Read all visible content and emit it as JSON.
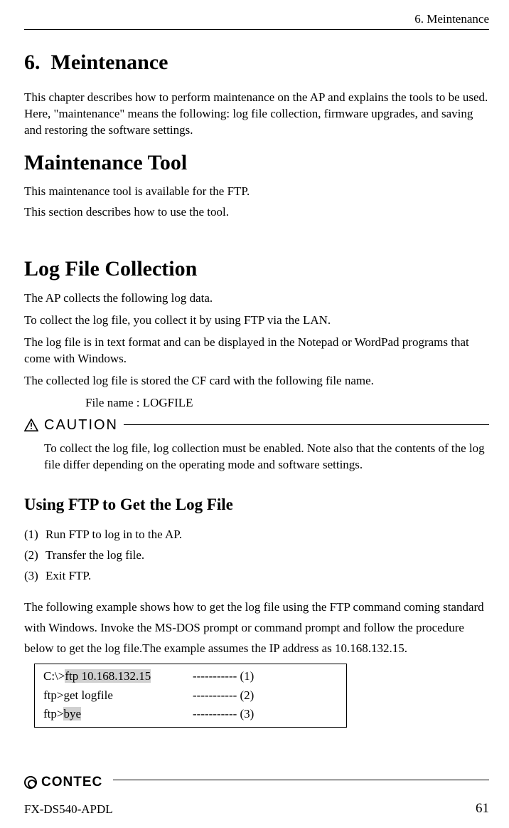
{
  "running_head": "6. Meintenance",
  "chapter": {
    "number": "6.",
    "title": "Meintenance"
  },
  "intro": "This chapter describes how to perform maintenance on the AP and explains the tools to be used.  Here, \"maintenance\" means the following: log file collection, firmware upgrades, and saving and restoring the software settings.",
  "section1": {
    "title": "Maintenance Tool",
    "p1": "This maintenance tool is available for the FTP.",
    "p2": "This section describes how to use the tool."
  },
  "section2": {
    "title": "Log File Collection",
    "p1": "The AP collects the following log data.",
    "p2": "To collect the log file, you collect it by using FTP via the LAN.",
    "p3": "The log file is in text format and can be displayed in the Notepad or WordPad programs that come with Windows.",
    "p4": "The collected log file is stored the CF card with the following file name.",
    "file_line": "File name : LOGFILE"
  },
  "caution": {
    "label": "CAUTION",
    "body": "To collect the log file, log collection must be enabled.  Note also that the contents of the log file differ depending on the operating mode and software settings."
  },
  "subsection": {
    "title": "Using FTP to Get the Log File",
    "steps": [
      {
        "n": "(1)",
        "t": "Run FTP to log in to the AP."
      },
      {
        "n": "(2)",
        "t": "Transfer the log file."
      },
      {
        "n": "(3)",
        "t": "Exit FTP."
      }
    ],
    "example_p": "The following example shows how to get the log file using the FTP command coming standard with Windows. Invoke the MS-DOS prompt or command prompt and follow the procedure below to get the log file.The example assumes the IP address as 10.168.132.15.",
    "cmd": [
      {
        "prefix": "C:\\>",
        "hl": "ftp 10.168.132.15",
        "suffix": "",
        "marker": "----------- (1)"
      },
      {
        "prefix": "ftp>get logfile",
        "hl": "",
        "suffix": "",
        "marker": "----------- (2)"
      },
      {
        "prefix": "ftp>",
        "hl": "bye",
        "suffix": "",
        "marker": "----------- (3)"
      }
    ]
  },
  "footer": {
    "brand": "CONTEC",
    "model": "FX-DS540-APDL",
    "page": "61"
  }
}
